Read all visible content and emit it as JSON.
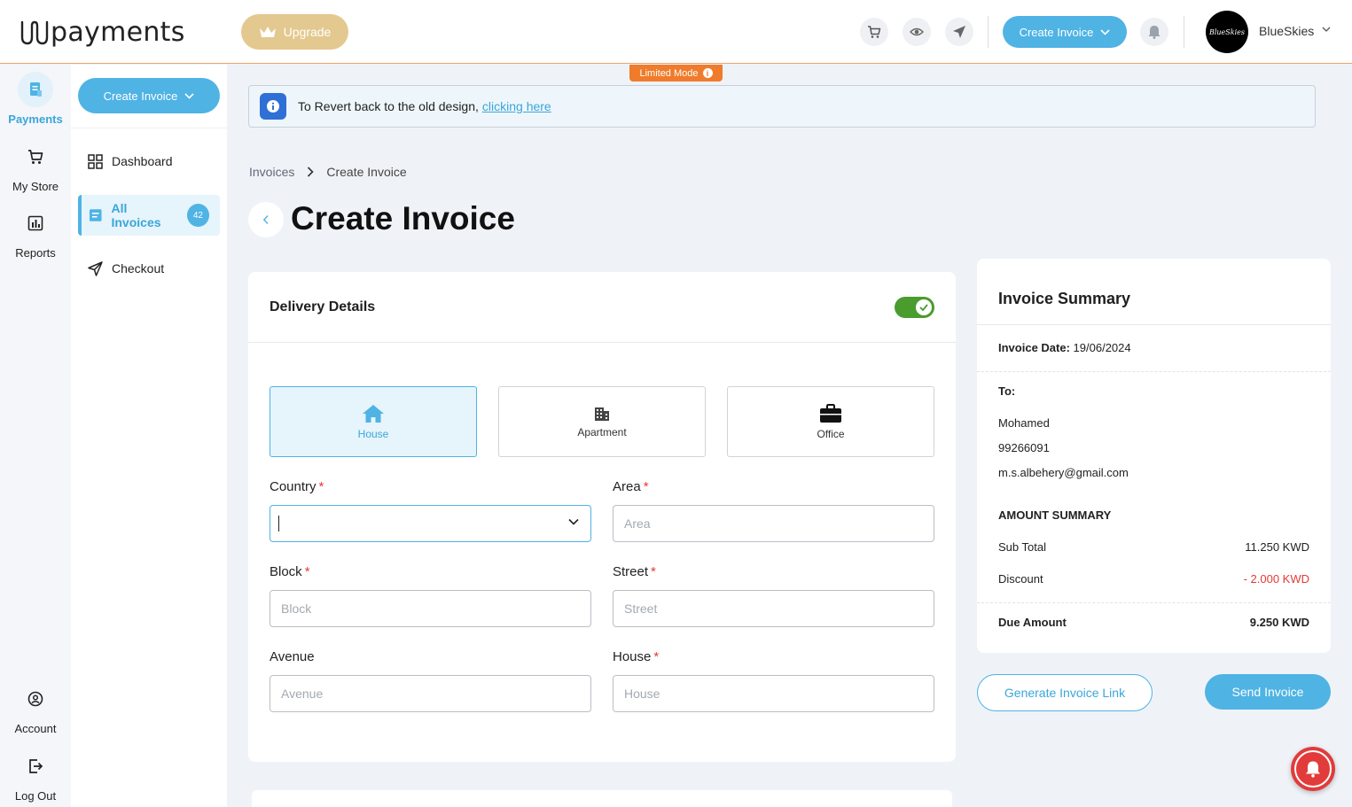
{
  "header": {
    "logo_text": "payments",
    "upgrade_label": "Upgrade",
    "create_invoice_label": "Create Invoice",
    "avatar_text": "BlueSkies",
    "user_name": "BlueSkies"
  },
  "rail": {
    "payments": "Payments",
    "my_store": "My Store",
    "reports": "Reports",
    "account": "Account",
    "log_out": "Log Out"
  },
  "sidebar": {
    "create_invoice_label": "Create Invoice",
    "items": [
      {
        "label": "Dashboard"
      },
      {
        "label": "All Invoices",
        "badge": "42"
      },
      {
        "label": "Checkout"
      }
    ]
  },
  "banner": {
    "limited_mode": "Limited Mode",
    "revert_text": "To Revert back to the old design,",
    "revert_link": "clicking here"
  },
  "breadcrumb": {
    "parent": "Invoices",
    "current": "Create Invoice"
  },
  "page_title": "Create Invoice",
  "delivery": {
    "title": "Delivery Details",
    "toggle_on": true,
    "types": [
      "House",
      "Apartment",
      "Office"
    ],
    "selected_type": "House",
    "fields": {
      "country": {
        "label": "Country",
        "value": "",
        "required": true
      },
      "area": {
        "label": "Area",
        "placeholder": "Area",
        "required": true
      },
      "block": {
        "label": "Block",
        "placeholder": "Block",
        "required": true
      },
      "street": {
        "label": "Street",
        "placeholder": "Street",
        "required": true
      },
      "avenue": {
        "label": "Avenue",
        "placeholder": "Avenue",
        "required": false
      },
      "house": {
        "label": "House",
        "placeholder": "House",
        "required": true
      }
    },
    "required_mark": "*"
  },
  "summary": {
    "title": "Invoice Summary",
    "date_label": "Invoice Date:",
    "date_value": "19/06/2024",
    "to_label": "To:",
    "to_name": "Mohamed",
    "to_phone": "99266091",
    "to_email": "m.s.albehery@gmail.com",
    "amount_heading": "AMOUNT SUMMARY",
    "subtotal_label": "Sub Total",
    "subtotal_value": "11.250 KWD",
    "discount_label": "Discount",
    "discount_value": "- 2.000 KWD",
    "due_label": "Due Amount",
    "due_value": "9.250 KWD"
  },
  "actions": {
    "generate_link": "Generate Invoice Link",
    "send": "Send Invoice"
  },
  "colors": {
    "accent": "#4fb3e4",
    "upgrade": "#e3c98f",
    "limited_mode": "#ef7b2b",
    "toggle_on": "#4a9c2f",
    "discount": "#e53935",
    "notification_fab": "#e23b3b"
  }
}
